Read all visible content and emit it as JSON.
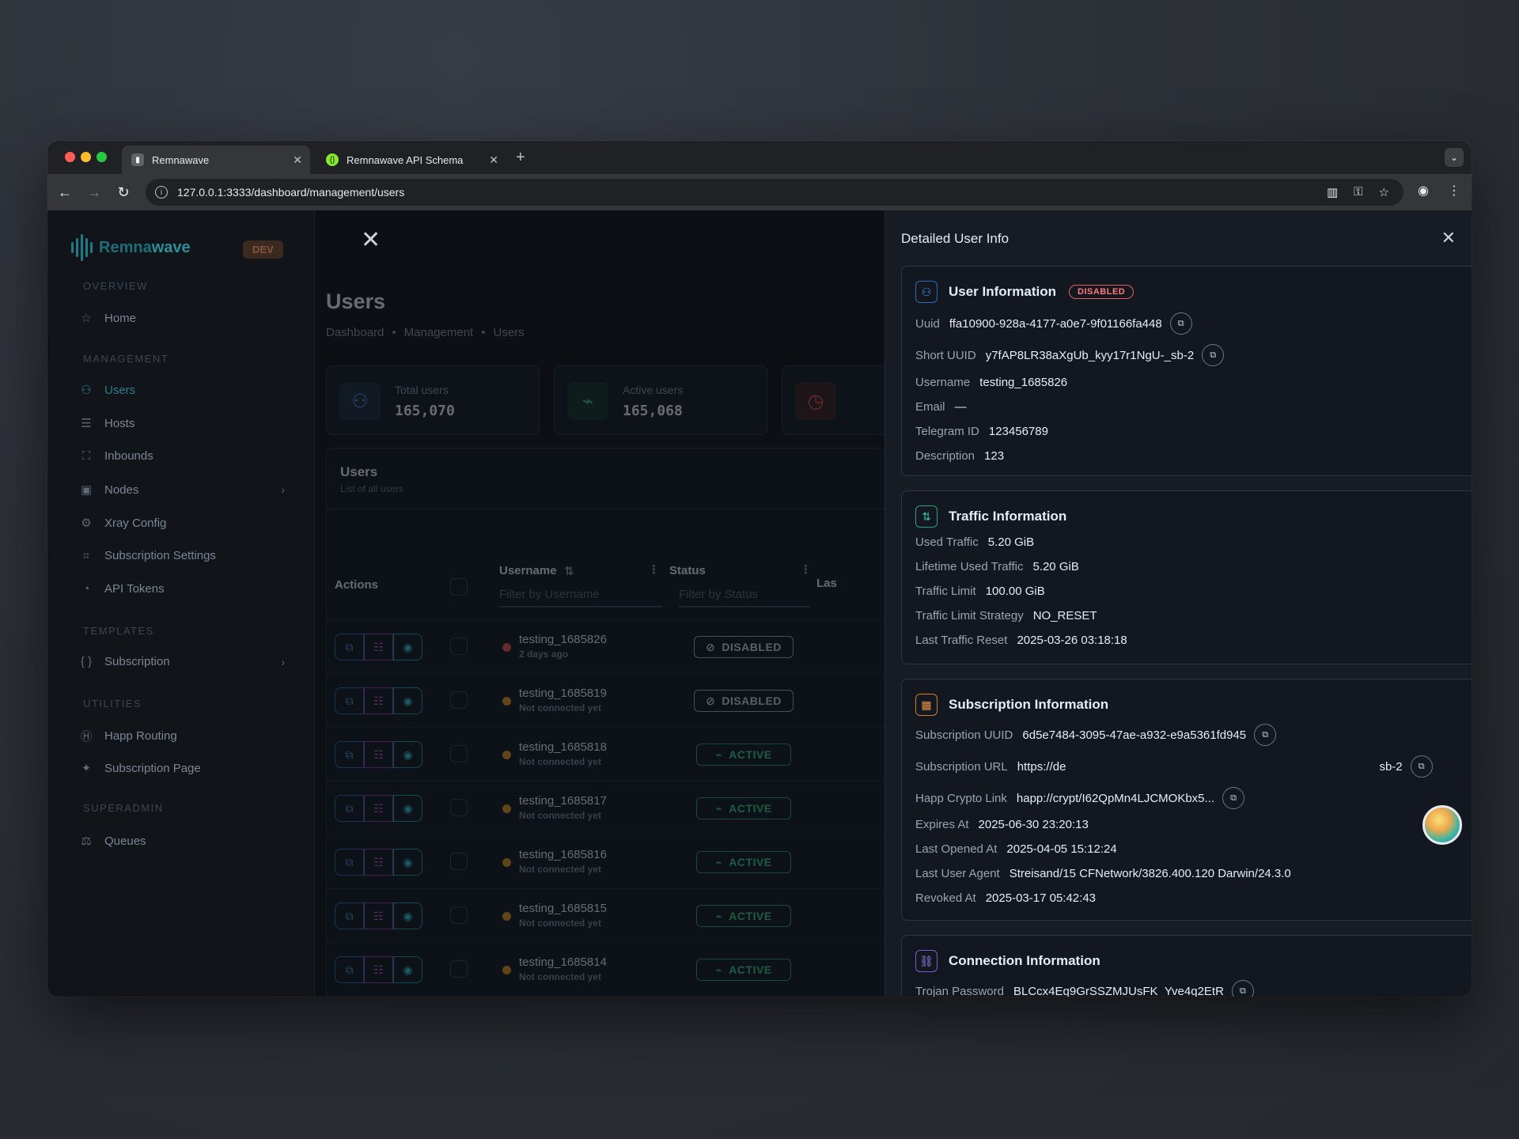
{
  "browser": {
    "tabs": [
      {
        "title": "Remnawave",
        "active": true
      },
      {
        "title": "Remnawave API Schema",
        "active": false
      }
    ],
    "url": "127.0.0.1:3333/dashboard/management/users"
  },
  "sidebar": {
    "brand": {
      "prefix": "Remna",
      "suffix": "wave",
      "badge": "DEV"
    },
    "sections": {
      "overview": "OVERVIEW",
      "management": "MANAGEMENT",
      "templates": "TEMPLATES",
      "utilities": "UTILITIES",
      "superadmin": "SUPERADMIN"
    },
    "items": {
      "home": "Home",
      "users": "Users",
      "hosts": "Hosts",
      "inbounds": "Inbounds",
      "nodes": "Nodes",
      "xray": "Xray Config",
      "subscription_settings": "Subscription Settings",
      "api_tokens": "API Tokens",
      "subscription": "Subscription",
      "happ_routing": "Happ Routing",
      "subscription_page": "Subscription Page",
      "queues": "Queues"
    }
  },
  "main": {
    "title": "Users",
    "breadcrumbs": [
      "Dashboard",
      "Management",
      "Users"
    ],
    "stats": [
      {
        "label": "Total users",
        "value": "165,070"
      },
      {
        "label": "Active users",
        "value": "165,068"
      }
    ],
    "table": {
      "title": "Users",
      "subtitle": "List of all users",
      "headers": {
        "actions": "Actions",
        "username": "Username",
        "status": "Status",
        "last": "Las"
      },
      "filters": {
        "username": "Filter by Username",
        "status": "Filter by Status"
      },
      "rows": [
        {
          "username": "testing_1685826",
          "sub": "2 days ago",
          "status": "DISABLED",
          "dot": "#e5534b"
        },
        {
          "username": "testing_1685819",
          "sub": "Not connected yet",
          "status": "DISABLED",
          "dot": "#d4911e"
        },
        {
          "username": "testing_1685818",
          "sub": "Not connected yet",
          "status": "ACTIVE",
          "dot": "#d4911e"
        },
        {
          "username": "testing_1685817",
          "sub": "Not connected yet",
          "status": "ACTIVE",
          "dot": "#d4911e"
        },
        {
          "username": "testing_1685816",
          "sub": "Not connected yet",
          "status": "ACTIVE",
          "dot": "#d4911e"
        },
        {
          "username": "testing_1685815",
          "sub": "Not connected yet",
          "status": "ACTIVE",
          "dot": "#d4911e"
        },
        {
          "username": "testing_1685814",
          "sub": "Not connected yet",
          "status": "ACTIVE",
          "dot": "#d4911e"
        }
      ]
    }
  },
  "drawer": {
    "title": "Detailed User Info",
    "user": {
      "title": "User Information",
      "status_chip": "DISABLED",
      "uuid": {
        "k": "Uuid",
        "v": "ffa10900-928a-4177-a0e7-9f01166fa448"
      },
      "short_uuid": {
        "k": "Short UUID",
        "v": "y7fAP8LR38aXgUb_kyy17r1NgU-_sb-2"
      },
      "username": {
        "k": "Username",
        "v": "testing_1685826"
      },
      "email": {
        "k": "Email",
        "v": "—"
      },
      "telegram": {
        "k": "Telegram ID",
        "v": "123456789"
      },
      "description": {
        "k": "Description",
        "v": "123"
      }
    },
    "traffic": {
      "title": "Traffic Information",
      "used": {
        "k": "Used Traffic",
        "v": "5.20 GiB"
      },
      "lifetime": {
        "k": "Lifetime Used Traffic",
        "v": "5.20 GiB"
      },
      "limit": {
        "k": "Traffic Limit",
        "v": "100.00 GiB"
      },
      "strategy": {
        "k": "Traffic Limit Strategy",
        "v": "NO_RESET"
      },
      "last_reset": {
        "k": "Last Traffic Reset",
        "v": "2025-03-26 03:18:18"
      }
    },
    "subscription": {
      "title": "Subscription Information",
      "uuid": {
        "k": "Subscription UUID",
        "v": "6d5e7484-3095-47ae-a932-e9a5361fd945"
      },
      "url": {
        "k": "Subscription URL",
        "v": "https://de",
        "tail": "sb-2"
      },
      "happ": {
        "k": "Happ Crypto Link",
        "v": "happ://crypt/I62QpMn4LJCMOKbx5..."
      },
      "expires": {
        "k": "Expires At",
        "v": "2025-06-30 23:20:13"
      },
      "last_opened": {
        "k": "Last Opened At",
        "v": "2025-04-05 15:12:24"
      },
      "agent": {
        "k": "Last User Agent",
        "v": "Streisand/15 CFNetwork/3826.400.120 Darwin/24.3.0"
      },
      "revoked": {
        "k": "Revoked At",
        "v": "2025-03-17 05:42:43"
      }
    },
    "connection": {
      "title": "Connection Information",
      "trojan": {
        "k": "Trojan Password",
        "v": "BLCcx4Eq9GrSSZMJUsFK_Yve4q2EtR"
      }
    }
  }
}
